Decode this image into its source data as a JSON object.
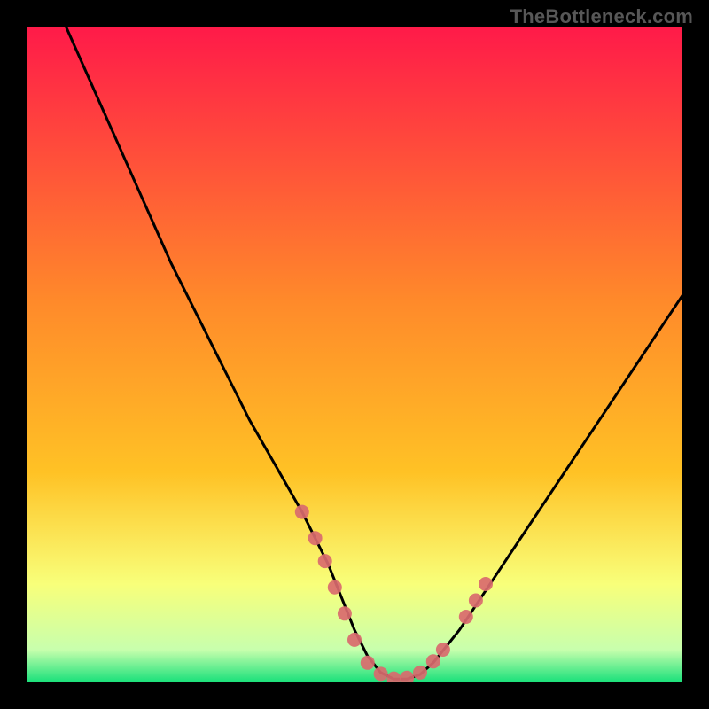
{
  "watermark": "TheBottleneck.com",
  "colors": {
    "background": "#000000",
    "gradient_top": "#ff1a49",
    "gradient_mid": "#ffc225",
    "gradient_low": "#f8ff7a",
    "gradient_bottom": "#18e07a",
    "curve": "#000000",
    "markers": "#d96a6e"
  },
  "chart_data": {
    "type": "line",
    "title": "",
    "xlabel": "",
    "ylabel": "",
    "xlim": [
      0,
      100
    ],
    "ylim": [
      0,
      100
    ],
    "series": [
      {
        "name": "bottleneck-curve",
        "x": [
          6,
          10,
          14,
          18,
          22,
          26,
          30,
          34,
          38,
          42,
          46,
          48,
          50,
          52,
          54,
          56,
          58,
          60,
          62,
          66,
          70,
          74,
          78,
          82,
          86,
          90,
          94,
          98,
          100
        ],
        "values": [
          100,
          91,
          82,
          73,
          64,
          56,
          48,
          40,
          33,
          26,
          18,
          13,
          8,
          4,
          1.5,
          0.5,
          0.5,
          1.2,
          3,
          8,
          14,
          20,
          26,
          32,
          38,
          44,
          50,
          56,
          59
        ]
      }
    ],
    "markers": {
      "name": "highlight-dots",
      "points": [
        {
          "x": 42,
          "y": 26
        },
        {
          "x": 44,
          "y": 22
        },
        {
          "x": 45.5,
          "y": 18.5
        },
        {
          "x": 47,
          "y": 14.5
        },
        {
          "x": 48.5,
          "y": 10.5
        },
        {
          "x": 50,
          "y": 6.5
        },
        {
          "x": 52,
          "y": 3
        },
        {
          "x": 54,
          "y": 1.3
        },
        {
          "x": 56,
          "y": 0.6
        },
        {
          "x": 58,
          "y": 0.7
        },
        {
          "x": 60,
          "y": 1.5
        },
        {
          "x": 62,
          "y": 3.2
        },
        {
          "x": 63.5,
          "y": 5
        },
        {
          "x": 67,
          "y": 10
        },
        {
          "x": 68.5,
          "y": 12.5
        },
        {
          "x": 70,
          "y": 15
        }
      ]
    }
  }
}
